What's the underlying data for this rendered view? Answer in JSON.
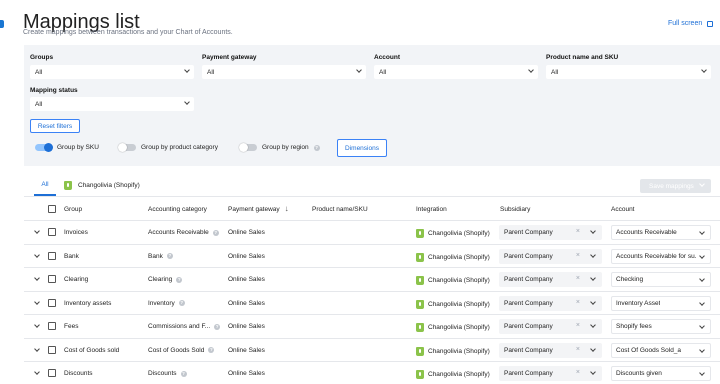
{
  "header": {
    "title": "Mappings list",
    "subtitle": "Create mappings between transactions and your Chart of Accounts.",
    "fullscreen_label": "Full screen"
  },
  "filters": {
    "groups": {
      "label": "Groups",
      "value": "All"
    },
    "payment_gateway": {
      "label": "Payment gateway",
      "value": "All"
    },
    "account": {
      "label": "Account",
      "value": "All"
    },
    "product": {
      "label": "Product name and SKU",
      "value": "All"
    },
    "mapping_status": {
      "label": "Mapping status",
      "value": "All"
    },
    "reset_label": "Reset filters",
    "toggles": {
      "by_sku": {
        "label": "Group by SKU",
        "on": true
      },
      "by_category": {
        "label": "Group by product category",
        "on": false
      },
      "by_region": {
        "label": "Group by region",
        "on": false
      }
    },
    "dimensions_label": "Dimensions"
  },
  "tabs": {
    "all": "All",
    "store": "Changolivia (Shopify)",
    "save_label": "Save mappings"
  },
  "table": {
    "columns": [
      "Group",
      "Accounting category",
      "Payment gateway",
      "Product name/SKU",
      "Integration",
      "Subsidiary",
      "Account"
    ],
    "rows": [
      {
        "group": "Invoices",
        "category": "Accounts Receivable",
        "gateway": "Online Sales",
        "integration": "Changolivia (Shopify)",
        "subsidiary": "Parent Company",
        "account": "Accounts Receivable"
      },
      {
        "group": "Bank",
        "category": "Bank",
        "gateway": "Online Sales",
        "integration": "Changolivia (Shopify)",
        "subsidiary": "Parent Company",
        "account": "Accounts Receivable for su..."
      },
      {
        "group": "Clearing",
        "category": "Clearing",
        "gateway": "Online Sales",
        "integration": "Changolivia (Shopify)",
        "subsidiary": "Parent Company",
        "account": "Checking"
      },
      {
        "group": "Inventory assets",
        "category": "Inventory",
        "gateway": "Online Sales",
        "integration": "Changolivia (Shopify)",
        "subsidiary": "Parent Company",
        "account": "Inventory Asset"
      },
      {
        "group": "Fees",
        "category": "Commissions and F...",
        "gateway": "Online Sales",
        "integration": "Changolivia (Shopify)",
        "subsidiary": "Parent Company",
        "account": "Shopify fees"
      },
      {
        "group": "Cost of Goods sold",
        "category": "Cost of Goods Sold",
        "gateway": "Online Sales",
        "integration": "Changolivia (Shopify)",
        "subsidiary": "Parent Company",
        "account": "Cost Of Goods Sold_a"
      },
      {
        "group": "Discounts",
        "category": "Discounts",
        "gateway": "Online Sales",
        "integration": "Changolivia (Shopify)",
        "subsidiary": "Parent Company",
        "account": "Discounts given"
      }
    ]
  },
  "colors": {
    "accent": "#1d6fd6",
    "filter_bg": "#f2f4f7",
    "shopify": "#8bc34a"
  }
}
